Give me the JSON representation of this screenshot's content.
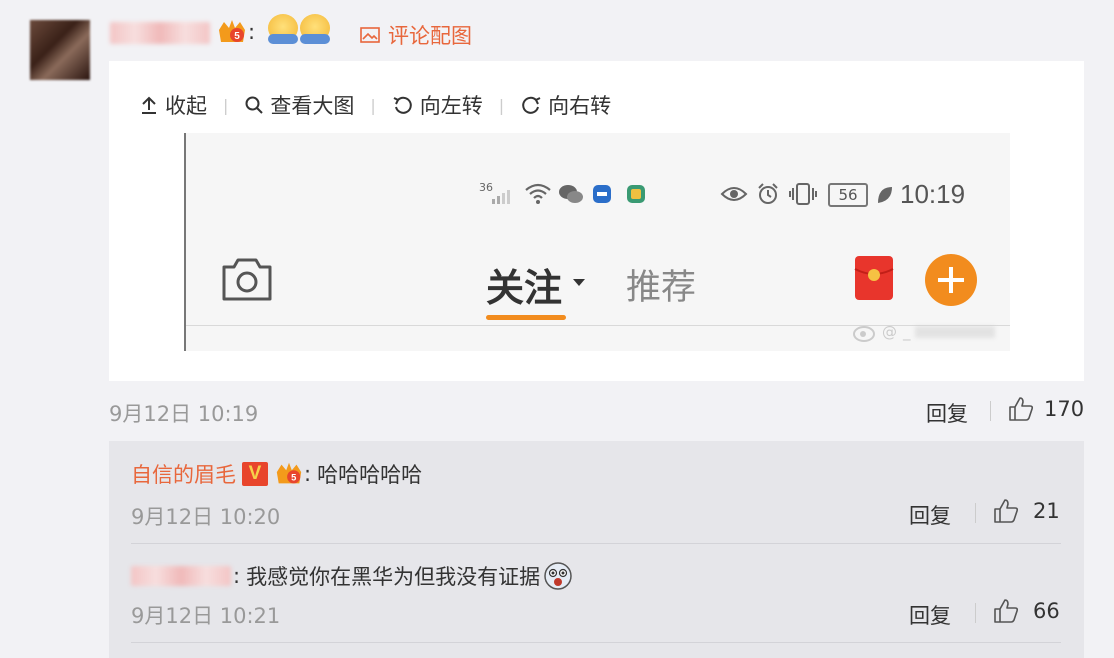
{
  "comment": {
    "separator": ":",
    "image_link": "评论配图",
    "toolbar": {
      "collapse": "收起",
      "view_large": "查看大图",
      "rotate_left": "向左转",
      "rotate_right": "向右转"
    },
    "embedded_screenshot": {
      "signal_label": "36",
      "battery": "56",
      "clock": "10:19",
      "tab_follow": "关注",
      "tab_recommend": "推荐",
      "watermark": "@  _"
    },
    "time": "9月12日 10:19",
    "reply_label": "回复",
    "likes": "170"
  },
  "replies": [
    {
      "nickname": "自信的眉毛",
      "verified_badge": "V",
      "separator": ":",
      "text": "哈哈哈哈哈",
      "time": "9月12日 10:20",
      "reply_label": "回复",
      "likes": "21"
    },
    {
      "separator": ":",
      "text": "我感觉你在黑华为但我没有证据",
      "time": "9月12日 10:21",
      "reply_label": "回复",
      "likes": "66"
    }
  ],
  "colors": {
    "accent": "#e8673c",
    "orange_tab": "#f28c1e",
    "background": "#f2f2f5",
    "reply_bg": "#e6e6ea"
  }
}
